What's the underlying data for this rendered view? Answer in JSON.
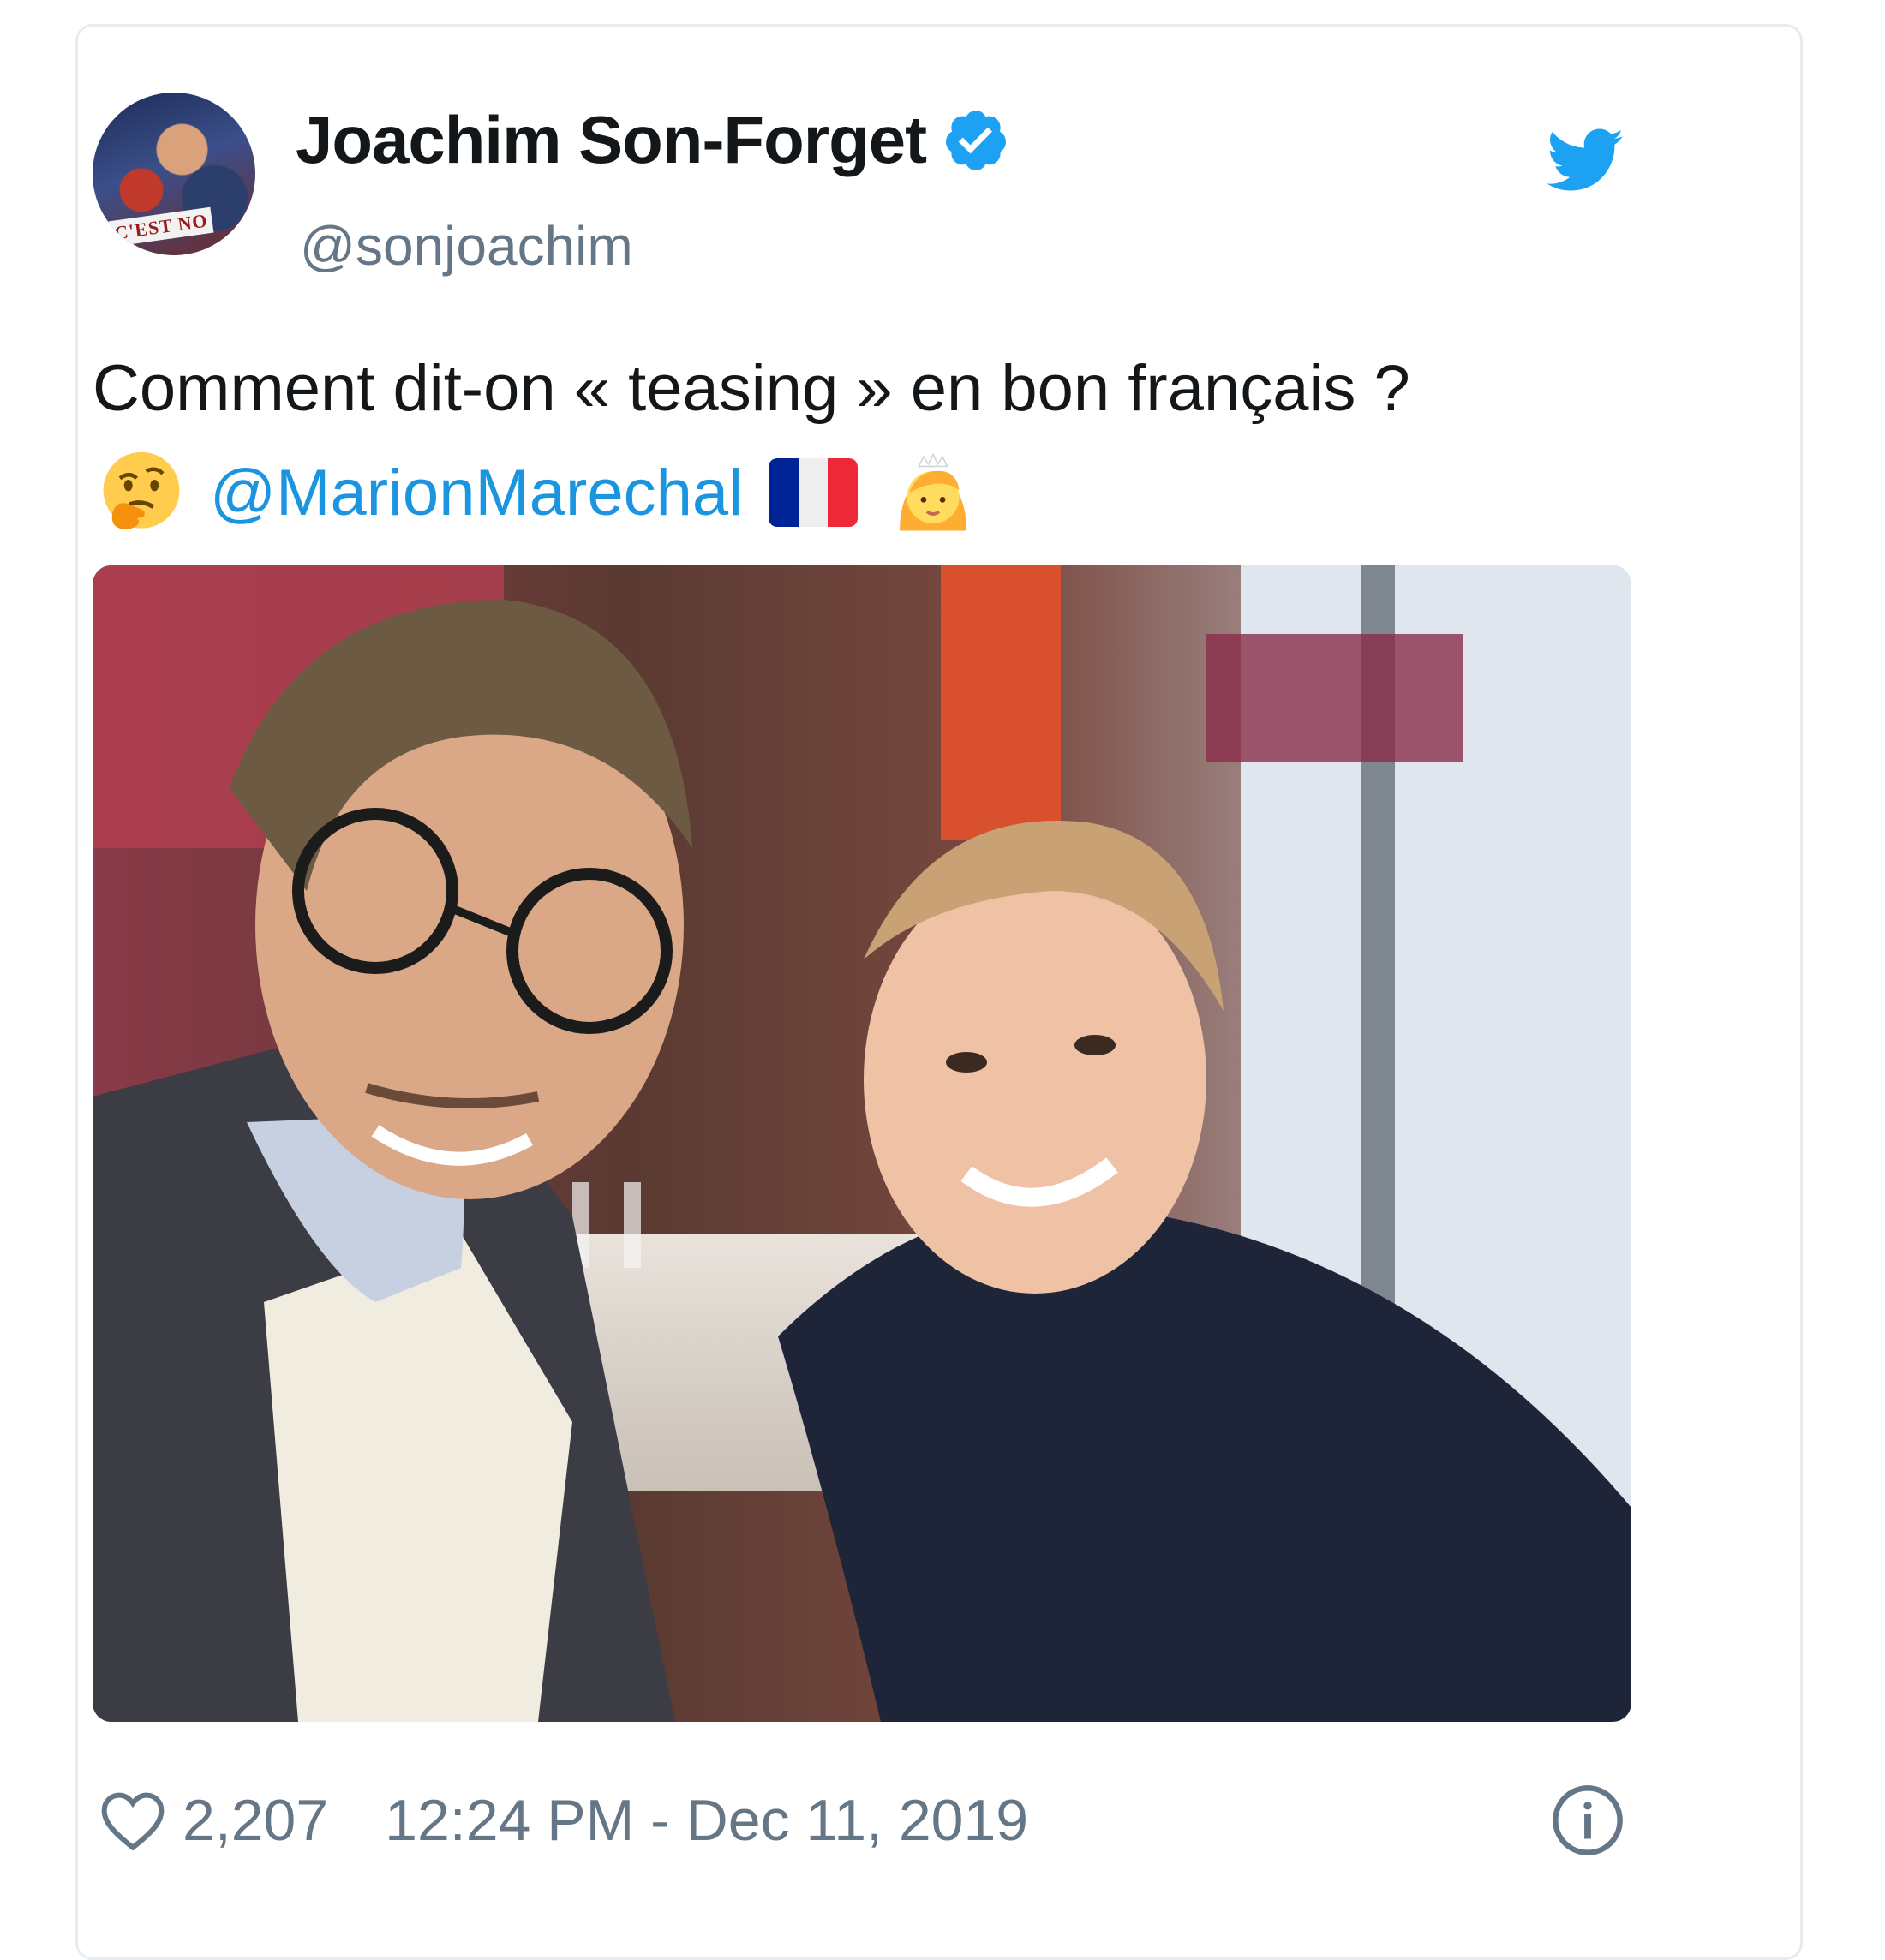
{
  "tweet": {
    "author": {
      "display_name": "Joachim Son-Forget",
      "handle": "@sonjoachim",
      "verified": true,
      "avatar_banner_text": "C'EST NO"
    },
    "text_line1": "Comment dit-on « teasing » en bon français ?",
    "mention": "@MarionMarechal",
    "emojis": [
      "thinking-face-icon",
      "france-flag-icon",
      "woman-with-crown-icon"
    ],
    "likes": "2,207",
    "timestamp": "12:24 PM - Dec 11, 2019",
    "colors": {
      "link_blue": "#1b95e0",
      "twitter_blue": "#1da1f2",
      "muted_gray": "#657786",
      "text_dark": "#14171a"
    }
  }
}
